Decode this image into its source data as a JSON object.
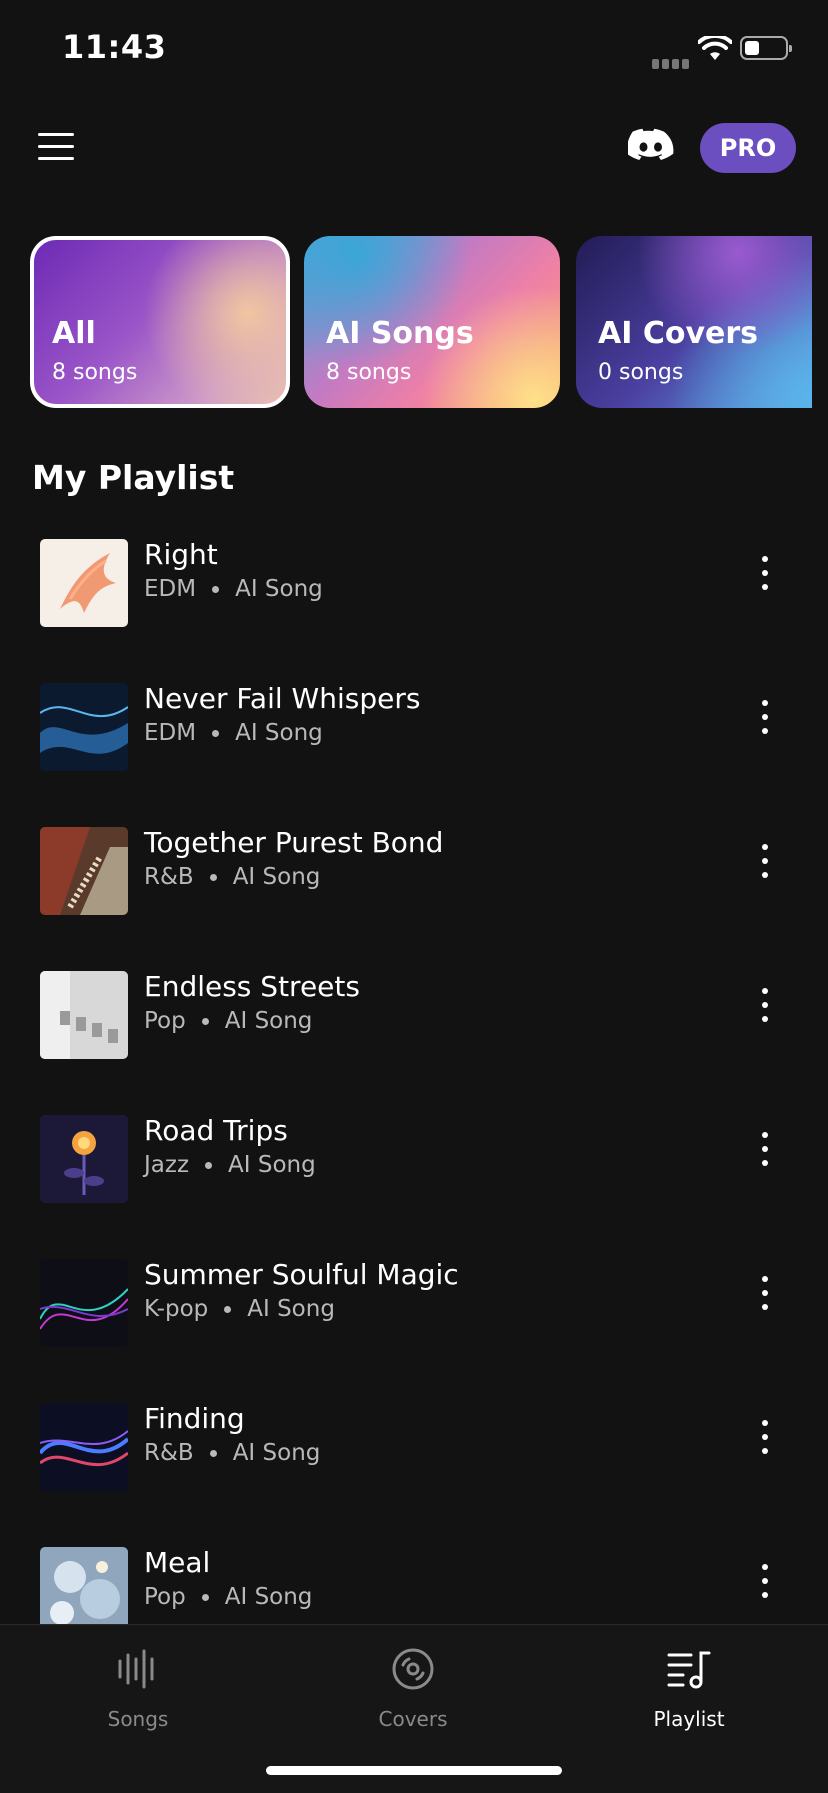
{
  "status_bar": {
    "time": "11:43"
  },
  "header": {
    "pro_label": "PRO",
    "discord_icon": "discord-icon",
    "menu_icon": "hamburger-menu-icon"
  },
  "categories": [
    {
      "name": "All",
      "count": "8 songs",
      "selected": true
    },
    {
      "name": "AI Songs",
      "count": "8 songs",
      "selected": false
    },
    {
      "name": "AI Covers",
      "count": "0 songs",
      "selected": false
    }
  ],
  "section": {
    "title": "My Playlist"
  },
  "songs": [
    {
      "title": "Right",
      "genre": "EDM",
      "type": "AI Song"
    },
    {
      "title": "Never Fail Whispers",
      "genre": "EDM",
      "type": "AI Song"
    },
    {
      "title": "Together Purest Bond",
      "genre": "R&B",
      "type": "AI Song"
    },
    {
      "title": "Endless Streets",
      "genre": "Pop",
      "type": "AI Song"
    },
    {
      "title": "Road Trips",
      "genre": "Jazz",
      "type": "AI Song"
    },
    {
      "title": "Summer Soulful Magic",
      "genre": "K-pop",
      "type": "AI Song"
    },
    {
      "title": "Finding",
      "genre": "R&B",
      "type": "AI Song"
    },
    {
      "title": "Meal",
      "genre": "Pop",
      "type": "AI Song"
    }
  ],
  "bottom_nav": [
    {
      "label": "Songs",
      "icon": "waveform-icon",
      "active": false
    },
    {
      "label": "Covers",
      "icon": "disc-icon",
      "active": false
    },
    {
      "label": "Playlist",
      "icon": "playlist-icon",
      "active": true
    }
  ],
  "colors": {
    "background": "#121212",
    "pro_accent": "#6b4fc0",
    "meta_text": "#b9b9b9",
    "nav_inactive": "#8a8a8a"
  }
}
